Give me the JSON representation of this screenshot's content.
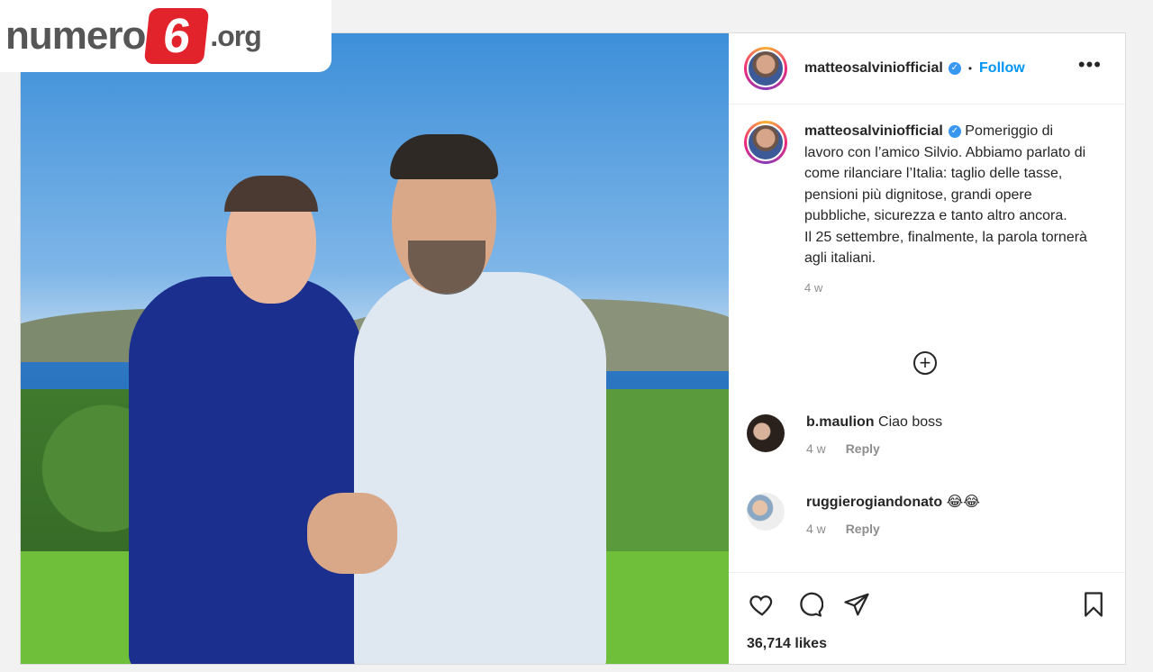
{
  "watermark": {
    "word": "numero",
    "digit": "6",
    "tld": ".org"
  },
  "post": {
    "username": "matteosalviniofficial",
    "follow_label": "Follow",
    "more_label": "•••",
    "separator": "•",
    "caption": "Pomeriggio di lavoro con l’amico Silvio. Abbiamo parlato di come rilanciare l’Italia: taglio delle tasse, pensioni più dignitose, grandi opere pubbliche, sicurezza e tanto altro ancora.\nIl 25 settembre, finalmente, la parola tornerà agli italiani.",
    "caption_time": "4 w",
    "load_more_icon": "plus-circle-icon",
    "comments": [
      {
        "username": "b.maulion",
        "text": "Ciao boss",
        "time": "4 w",
        "reply_label": "Reply"
      },
      {
        "username": "ruggierogiandonato",
        "text": "😂😂",
        "time": "4 w",
        "reply_label": "Reply"
      }
    ],
    "actions": [
      "heart-icon",
      "comment-icon",
      "share-icon",
      "bookmark-icon"
    ],
    "likes": "36,714 likes"
  },
  "colors": {
    "accent": "#0095f6",
    "verified": "#3897f0",
    "logo_red": "#e3232c"
  }
}
